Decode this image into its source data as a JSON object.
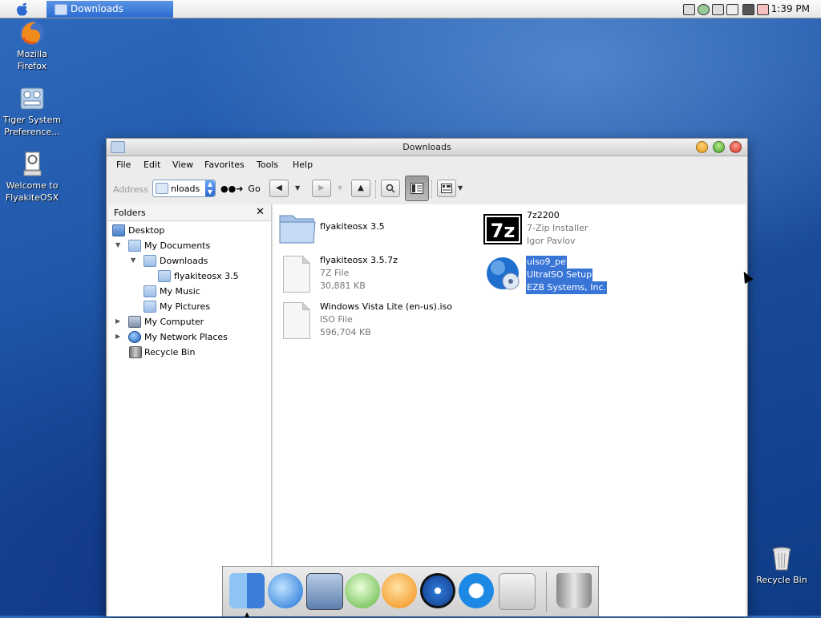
{
  "menubar": {
    "apple_icon": "apple-logo-icon",
    "active_task": "Downloads",
    "clock": "1:39 PM",
    "tray_icons": [
      "battery-icon",
      "user-icon",
      "network-icon",
      "printer-icon",
      "speaker-icon",
      "shield-icon"
    ]
  },
  "desktop": {
    "icons": [
      {
        "label1": "Mozilla",
        "label2": "Firefox",
        "icon": "firefox-icon"
      },
      {
        "label1": "Tiger System",
        "label2": "Preference...",
        "icon": "system-preferences-icon"
      },
      {
        "label1": "Welcome to",
        "label2": "FlyakiteOSX",
        "icon": "welcome-icon"
      },
      {
        "label1": "Recycle Bin",
        "label2": "",
        "icon": "recycle-bin-icon"
      }
    ]
  },
  "window": {
    "title": "Downloads",
    "menu": [
      "File",
      "Edit",
      "View",
      "Favorites",
      "Tools",
      "Help"
    ],
    "toolbar": {
      "address_label": "Address",
      "address_value": "nloads",
      "go_label": "Go"
    },
    "folders": {
      "header": "Folders",
      "close": "✕",
      "nodes": [
        {
          "label": "Desktop"
        },
        {
          "label": "My Documents"
        },
        {
          "label": "Downloads"
        },
        {
          "label": "flyakiteosx 3.5"
        },
        {
          "label": "My Music"
        },
        {
          "label": "My Pictures"
        },
        {
          "label": "My Computer"
        },
        {
          "label": "My Network Places"
        },
        {
          "label": "Recycle Bin"
        }
      ]
    },
    "files": [
      {
        "name": "flyakiteosx 3.5",
        "line2": "",
        "line3": "",
        "icon": "folder-icon"
      },
      {
        "name": "7z2200",
        "line2": "7-Zip Installer",
        "line3": "Igor Pavlov",
        "icon": "7zip-icon"
      },
      {
        "name": "flyakiteosx 3.5.7z",
        "line2": "7Z File",
        "line3": "30,881 KB",
        "icon": "document-icon"
      },
      {
        "name": "uiso9_pe",
        "line2": "UltraISO Setup",
        "line3": "EZB Systems, Inc.",
        "icon": "ultraiso-icon"
      },
      {
        "name": "Windows Vista Lite (en-us).iso",
        "line2": "ISO File",
        "line3": "596,704 KB",
        "icon": "document-icon"
      }
    ]
  },
  "dock": {
    "items": [
      "finder-icon",
      "internet-explorer-icon",
      "preview-icon",
      "itunes-icon",
      "media-player-icon",
      "dvd-player-icon",
      "quicktime-icon",
      "system-apple-icon",
      "trash-icon"
    ]
  }
}
